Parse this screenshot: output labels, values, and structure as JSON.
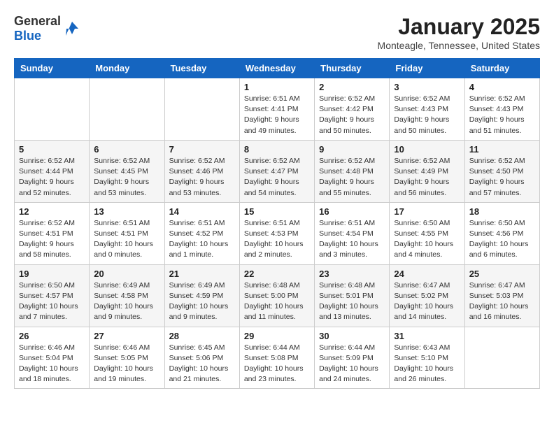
{
  "header": {
    "logo_general": "General",
    "logo_blue": "Blue",
    "title": "January 2025",
    "subtitle": "Monteagle, Tennessee, United States"
  },
  "weekdays": [
    "Sunday",
    "Monday",
    "Tuesday",
    "Wednesday",
    "Thursday",
    "Friday",
    "Saturday"
  ],
  "weeks": [
    [
      {
        "day": "",
        "info": ""
      },
      {
        "day": "",
        "info": ""
      },
      {
        "day": "",
        "info": ""
      },
      {
        "day": "1",
        "info": "Sunrise: 6:51 AM\nSunset: 4:41 PM\nDaylight: 9 hours\nand 49 minutes."
      },
      {
        "day": "2",
        "info": "Sunrise: 6:52 AM\nSunset: 4:42 PM\nDaylight: 9 hours\nand 50 minutes."
      },
      {
        "day": "3",
        "info": "Sunrise: 6:52 AM\nSunset: 4:43 PM\nDaylight: 9 hours\nand 50 minutes."
      },
      {
        "day": "4",
        "info": "Sunrise: 6:52 AM\nSunset: 4:43 PM\nDaylight: 9 hours\nand 51 minutes."
      }
    ],
    [
      {
        "day": "5",
        "info": "Sunrise: 6:52 AM\nSunset: 4:44 PM\nDaylight: 9 hours\nand 52 minutes."
      },
      {
        "day": "6",
        "info": "Sunrise: 6:52 AM\nSunset: 4:45 PM\nDaylight: 9 hours\nand 53 minutes."
      },
      {
        "day": "7",
        "info": "Sunrise: 6:52 AM\nSunset: 4:46 PM\nDaylight: 9 hours\nand 53 minutes."
      },
      {
        "day": "8",
        "info": "Sunrise: 6:52 AM\nSunset: 4:47 PM\nDaylight: 9 hours\nand 54 minutes."
      },
      {
        "day": "9",
        "info": "Sunrise: 6:52 AM\nSunset: 4:48 PM\nDaylight: 9 hours\nand 55 minutes."
      },
      {
        "day": "10",
        "info": "Sunrise: 6:52 AM\nSunset: 4:49 PM\nDaylight: 9 hours\nand 56 minutes."
      },
      {
        "day": "11",
        "info": "Sunrise: 6:52 AM\nSunset: 4:50 PM\nDaylight: 9 hours\nand 57 minutes."
      }
    ],
    [
      {
        "day": "12",
        "info": "Sunrise: 6:52 AM\nSunset: 4:51 PM\nDaylight: 9 hours\nand 58 minutes."
      },
      {
        "day": "13",
        "info": "Sunrise: 6:51 AM\nSunset: 4:51 PM\nDaylight: 10 hours\nand 0 minutes."
      },
      {
        "day": "14",
        "info": "Sunrise: 6:51 AM\nSunset: 4:52 PM\nDaylight: 10 hours\nand 1 minute."
      },
      {
        "day": "15",
        "info": "Sunrise: 6:51 AM\nSunset: 4:53 PM\nDaylight: 10 hours\nand 2 minutes."
      },
      {
        "day": "16",
        "info": "Sunrise: 6:51 AM\nSunset: 4:54 PM\nDaylight: 10 hours\nand 3 minutes."
      },
      {
        "day": "17",
        "info": "Sunrise: 6:50 AM\nSunset: 4:55 PM\nDaylight: 10 hours\nand 4 minutes."
      },
      {
        "day": "18",
        "info": "Sunrise: 6:50 AM\nSunset: 4:56 PM\nDaylight: 10 hours\nand 6 minutes."
      }
    ],
    [
      {
        "day": "19",
        "info": "Sunrise: 6:50 AM\nSunset: 4:57 PM\nDaylight: 10 hours\nand 7 minutes."
      },
      {
        "day": "20",
        "info": "Sunrise: 6:49 AM\nSunset: 4:58 PM\nDaylight: 10 hours\nand 9 minutes."
      },
      {
        "day": "21",
        "info": "Sunrise: 6:49 AM\nSunset: 4:59 PM\nDaylight: 10 hours\nand 9 minutes."
      },
      {
        "day": "22",
        "info": "Sunrise: 6:48 AM\nSunset: 5:00 PM\nDaylight: 10 hours\nand 11 minutes."
      },
      {
        "day": "23",
        "info": "Sunrise: 6:48 AM\nSunset: 5:01 PM\nDaylight: 10 hours\nand 13 minutes."
      },
      {
        "day": "24",
        "info": "Sunrise: 6:47 AM\nSunset: 5:02 PM\nDaylight: 10 hours\nand 14 minutes."
      },
      {
        "day": "25",
        "info": "Sunrise: 6:47 AM\nSunset: 5:03 PM\nDaylight: 10 hours\nand 16 minutes."
      }
    ],
    [
      {
        "day": "26",
        "info": "Sunrise: 6:46 AM\nSunset: 5:04 PM\nDaylight: 10 hours\nand 18 minutes."
      },
      {
        "day": "27",
        "info": "Sunrise: 6:46 AM\nSunset: 5:05 PM\nDaylight: 10 hours\nand 19 minutes."
      },
      {
        "day": "28",
        "info": "Sunrise: 6:45 AM\nSunset: 5:06 PM\nDaylight: 10 hours\nand 21 minutes."
      },
      {
        "day": "29",
        "info": "Sunrise: 6:44 AM\nSunset: 5:08 PM\nDaylight: 10 hours\nand 23 minutes."
      },
      {
        "day": "30",
        "info": "Sunrise: 6:44 AM\nSunset: 5:09 PM\nDaylight: 10 hours\nand 24 minutes."
      },
      {
        "day": "31",
        "info": "Sunrise: 6:43 AM\nSunset: 5:10 PM\nDaylight: 10 hours\nand 26 minutes."
      },
      {
        "day": "",
        "info": ""
      }
    ]
  ]
}
